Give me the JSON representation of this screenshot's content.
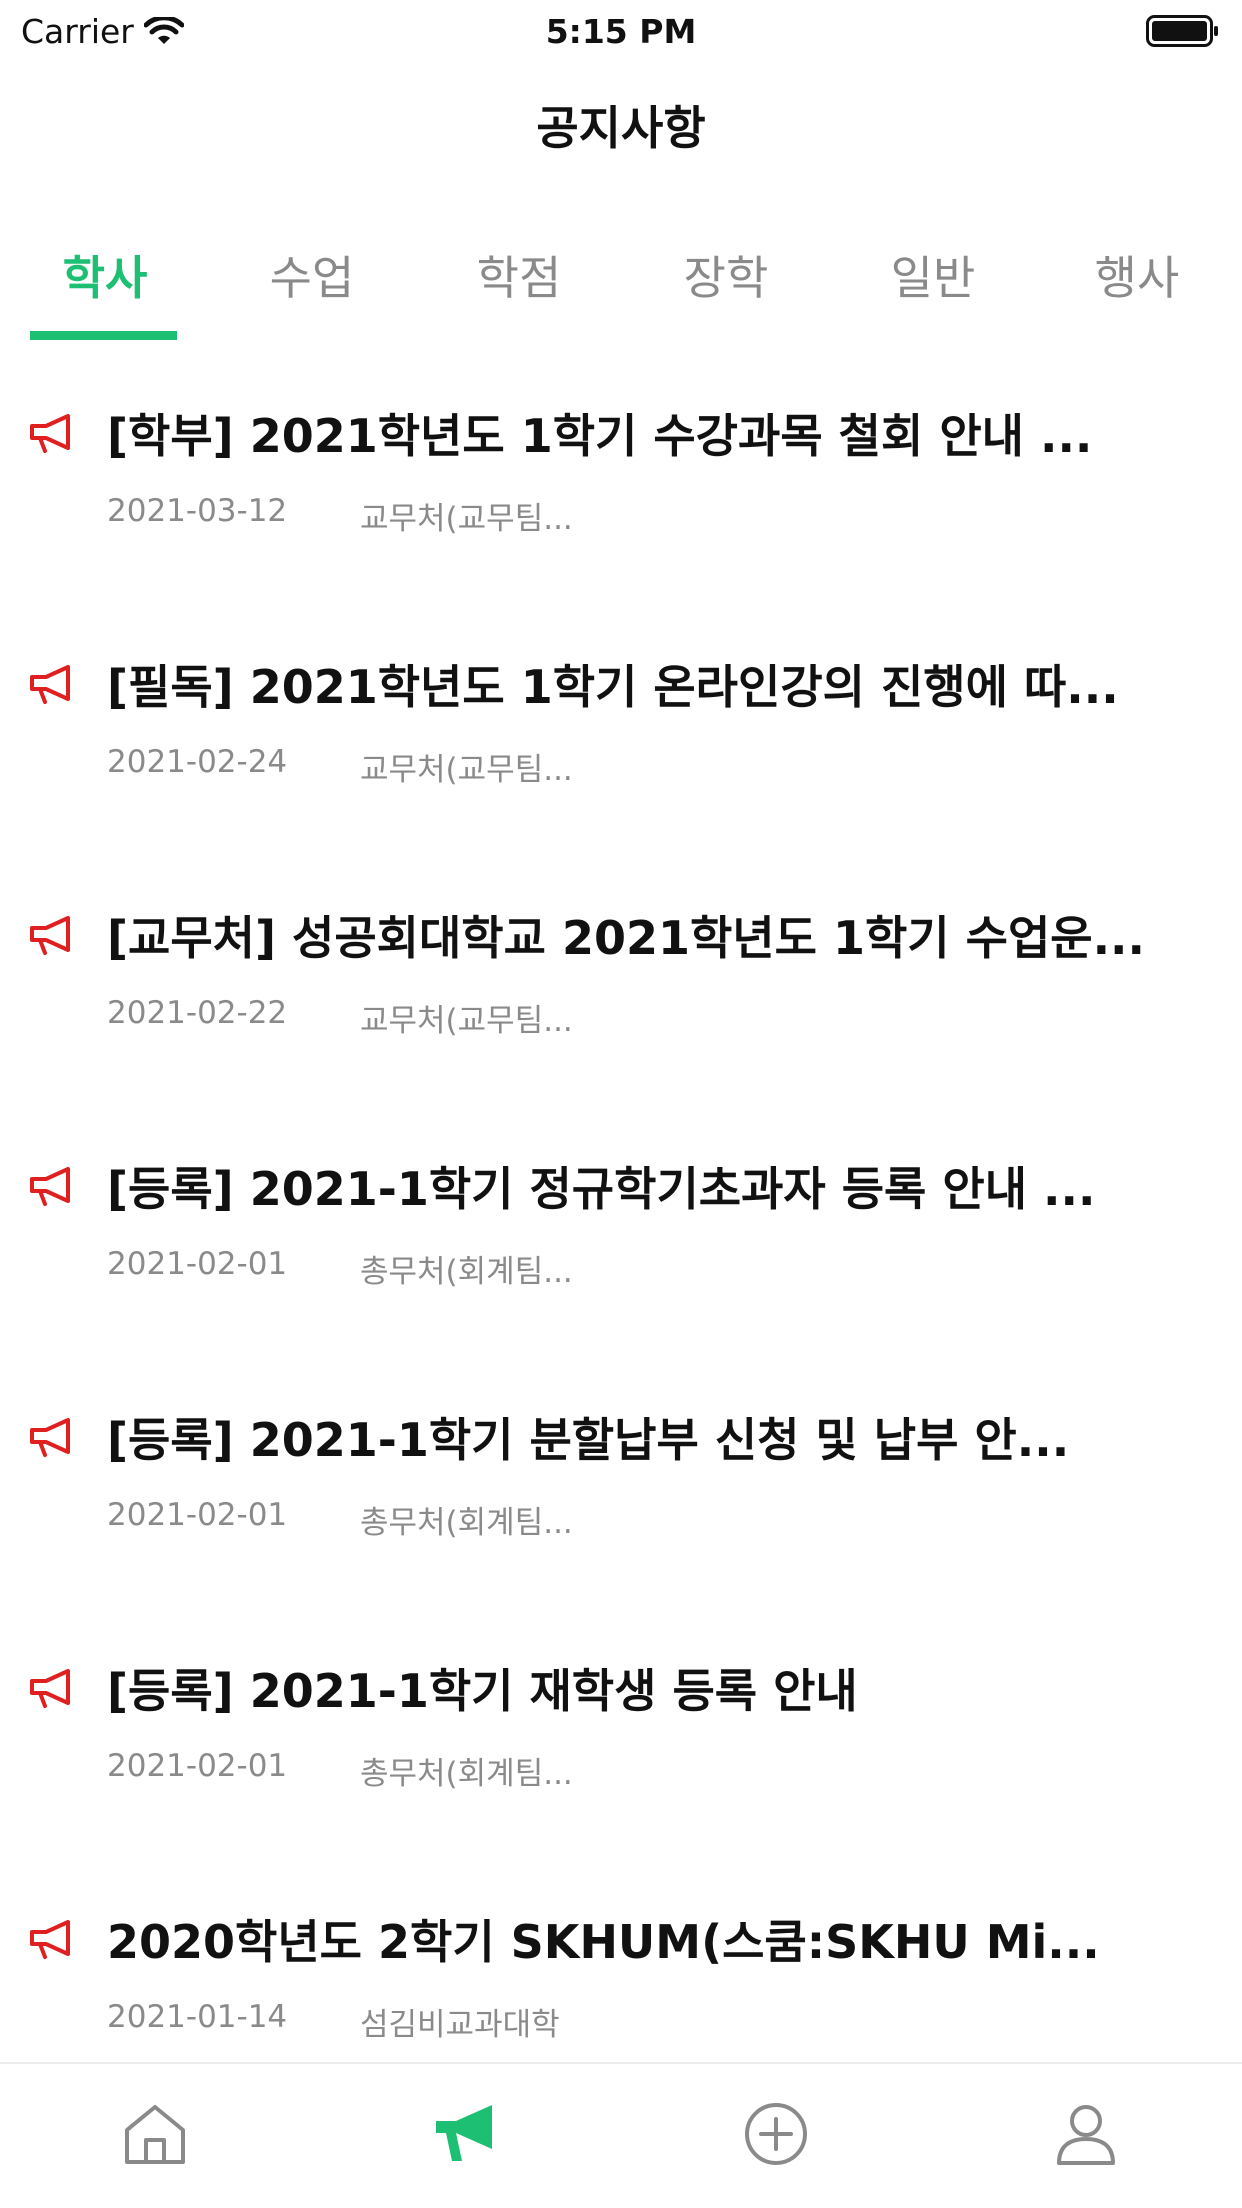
{
  "status": {
    "carrier": "Carrier",
    "time": "5:15 PM"
  },
  "nav": {
    "title": "공지사항"
  },
  "tabs": [
    {
      "label": "학사",
      "active": true
    },
    {
      "label": "수업",
      "active": false
    },
    {
      "label": "학점",
      "active": false
    },
    {
      "label": "장학",
      "active": false
    },
    {
      "label": "일반",
      "active": false
    },
    {
      "label": "행사",
      "active": false
    }
  ],
  "notices": [
    {
      "title": "[학부] 2021학년도 1학기 수강과목 철회 안내 ...",
      "date": "2021-03-12",
      "author": "교무처(교무팀..."
    },
    {
      "title": "[필독] 2021학년도 1학기 온라인강의 진행에 따...",
      "date": "2021-02-24",
      "author": "교무처(교무팀..."
    },
    {
      "title": "[교무처] 성공회대학교 2021학년도 1학기 수업운...",
      "date": "2021-02-22",
      "author": "교무처(교무팀..."
    },
    {
      "title": "[등록] 2021-1학기 정규학기초과자 등록 안내 ...",
      "date": "2021-02-01",
      "author": "총무처(회계팀..."
    },
    {
      "title": "[등록] 2021-1학기 분할납부 신청 및 납부 안...",
      "date": "2021-02-01",
      "author": "총무처(회계팀..."
    },
    {
      "title": "[등록] 2021-1학기 재학생 등록 안내",
      "date": "2021-02-01",
      "author": "총무처(회계팀..."
    },
    {
      "title": "2020학년도 2학기 SKHUM(스쿰:SKHU Mi...",
      "date": "2021-01-14",
      "author": "섬김비교과대학"
    }
  ],
  "tabbar": {
    "items": [
      {
        "icon": "home-icon"
      },
      {
        "icon": "megaphone-icon"
      },
      {
        "icon": "plus-circle-icon"
      },
      {
        "icon": "person-icon"
      }
    ]
  },
  "colors": {
    "accent": "#1dbf73",
    "notice_icon": "#e02020",
    "secondary_text": "#8a8a8a",
    "inactive_icon": "#8a8a8a"
  }
}
